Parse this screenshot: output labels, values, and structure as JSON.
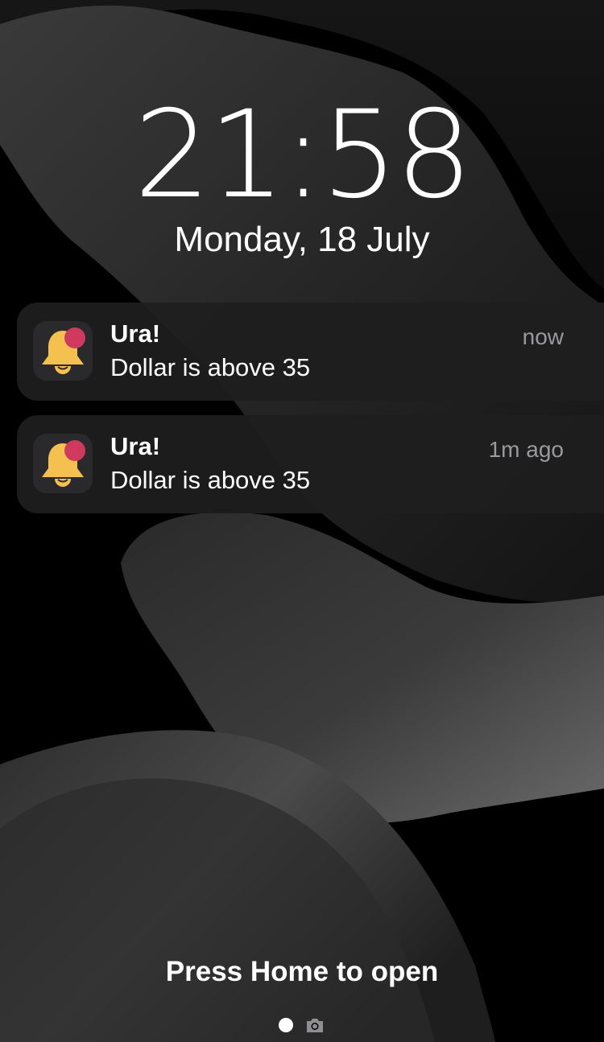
{
  "lockscreen": {
    "time": "21:58",
    "date": "Monday, 18 July",
    "footer_hint": "Press Home to open"
  },
  "notifications": [
    {
      "app_icon": "bell-icon",
      "title": "Ura!",
      "body": "Dollar is above 35",
      "time": "now"
    },
    {
      "app_icon": "bell-icon",
      "title": "Ura!",
      "body": "Dollar is above 35",
      "time": "1m ago"
    }
  ],
  "page_indicator": {
    "icons": [
      "dot-icon",
      "camera-icon"
    ]
  },
  "colors": {
    "background": "#000000",
    "notification_bg": "#1e1e1e",
    "bell": "#f4c04f",
    "badge": "#cf3a5e",
    "secondary_text": "#9a9a9e"
  }
}
